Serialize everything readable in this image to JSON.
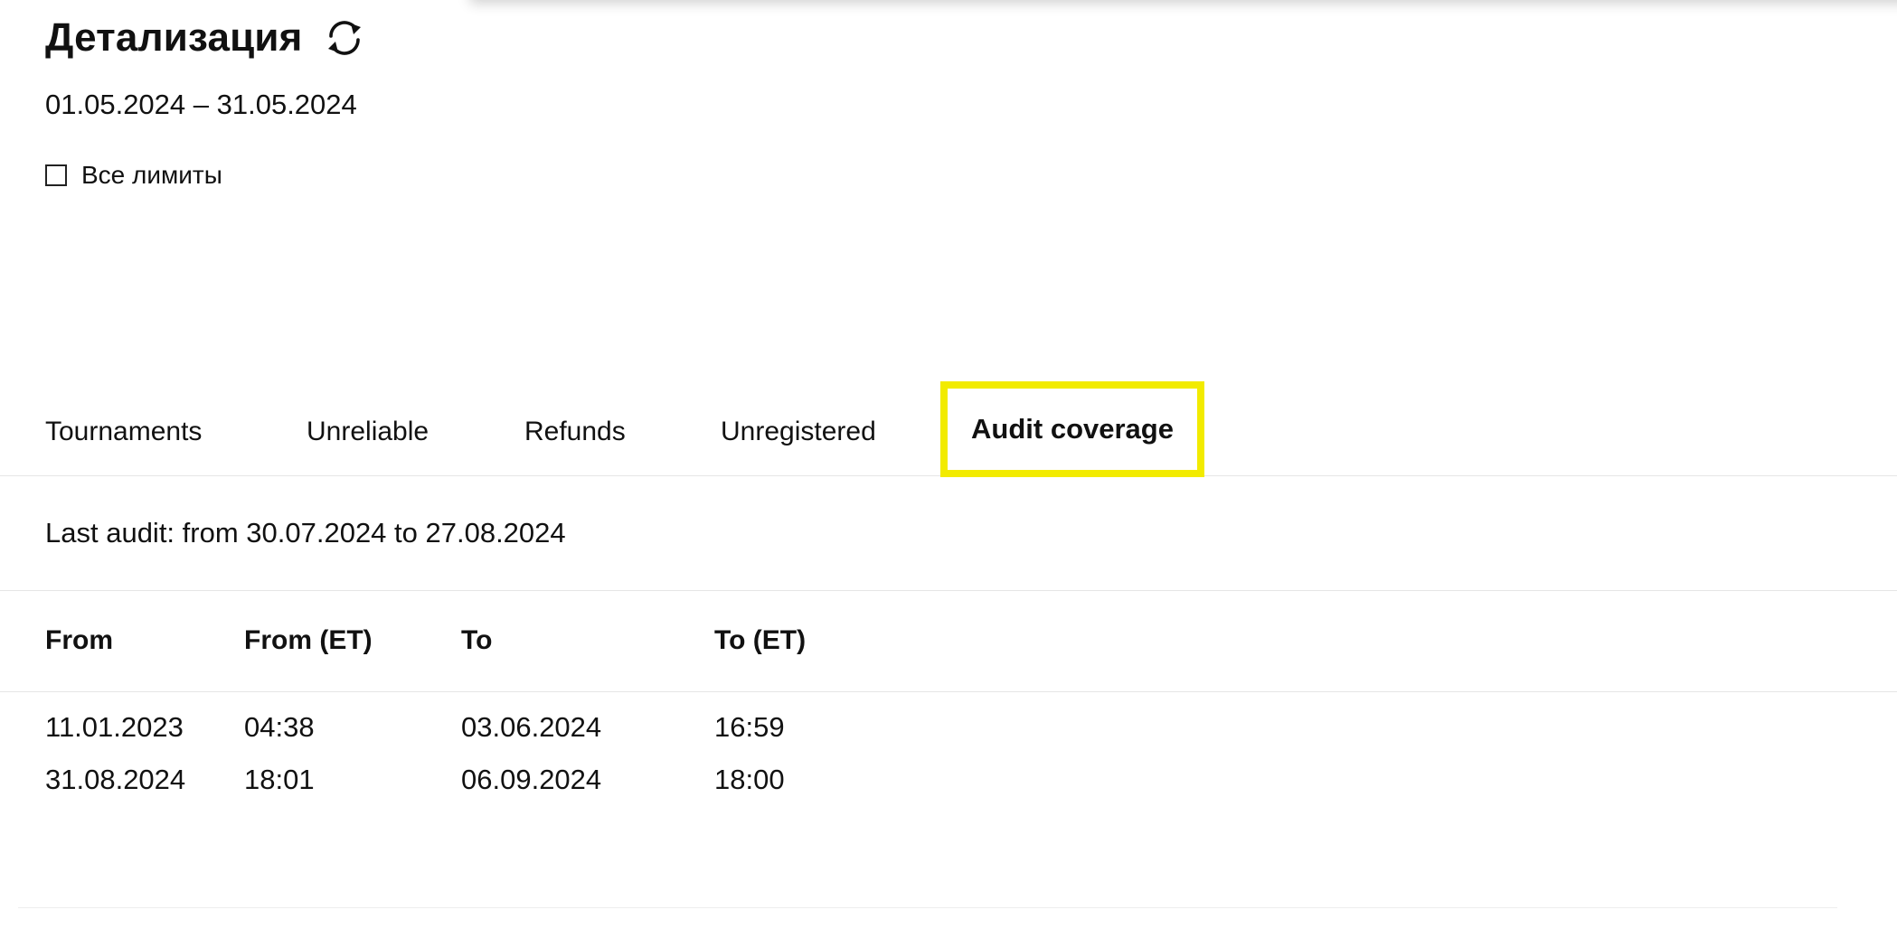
{
  "header": {
    "title": "Детализация",
    "refresh_icon": "refresh-icon"
  },
  "date_range": "01.05.2024 – 31.05.2024",
  "all_limits": {
    "label": "Все лимиты",
    "checked": false
  },
  "tabs": [
    {
      "label": "Tournaments",
      "active": false
    },
    {
      "label": "Unreliable",
      "active": false
    },
    {
      "label": "Refunds",
      "active": false
    },
    {
      "label": "Unregistered",
      "active": false
    },
    {
      "label": "Audit coverage",
      "active": true
    }
  ],
  "highlight_color": "#f2eb00",
  "last_audit": "Last audit: from 30.07.2024 to 27.08.2024",
  "table": {
    "headers": [
      "From",
      "From (ET)",
      "To",
      "To (ET)"
    ],
    "rows": [
      [
        "11.01.2023",
        "04:38",
        "03.06.2024",
        "16:59"
      ],
      [
        "31.08.2024",
        "18:01",
        "06.09.2024",
        "18:00"
      ]
    ]
  }
}
